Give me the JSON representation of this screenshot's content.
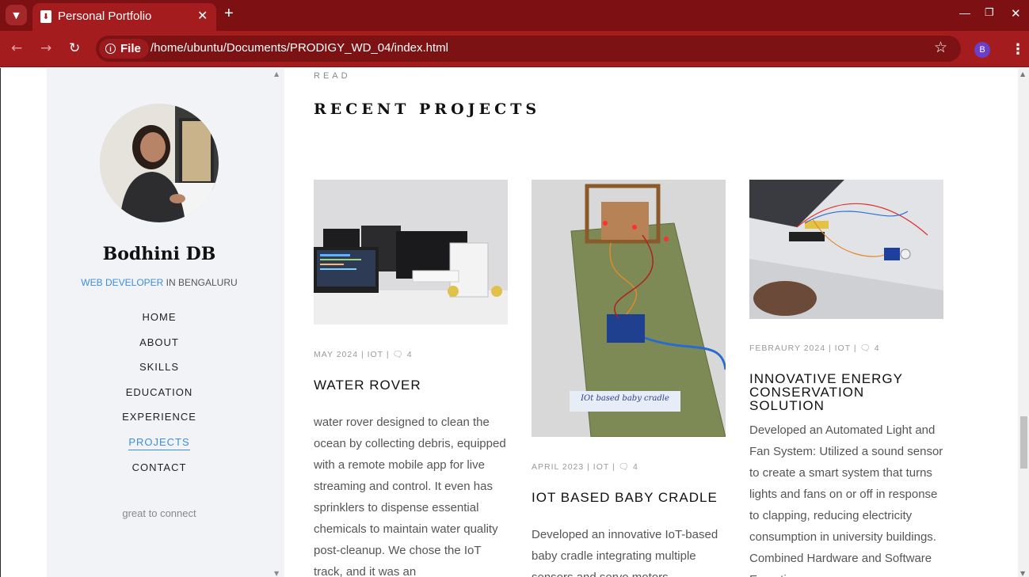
{
  "browser": {
    "tab_title": "Personal Portfolio",
    "url_chip": "File",
    "url": "/home/ubuntu/Documents/PRODIGY_WD_04/index.html",
    "profile_initial": "B"
  },
  "sidebar": {
    "name": "Bodhini DB",
    "role_highlight": "WEB DEVELOPER",
    "role_rest": " IN BENGALURU",
    "menu": [
      {
        "label": "HOME"
      },
      {
        "label": "ABOUT"
      },
      {
        "label": "SKILLS"
      },
      {
        "label": "EDUCATION"
      },
      {
        "label": "EXPERIENCE"
      },
      {
        "label": "PROJECTS",
        "active": true
      },
      {
        "label": "CONTACT"
      }
    ],
    "tagline": "great to connect"
  },
  "main": {
    "read_label": "READ",
    "section_title": "RECENT PROJECTS",
    "projects": [
      {
        "date": "MAY 2024",
        "category": "IOT",
        "comments": "4",
        "title": "WATER ROVER",
        "description": "water rover designed to clean the ocean by collecting debris, equipped with a remote mobile app for live streaming and control. It even has sprinklers to dispense essential chemicals to maintain water quality post-cleanup. We chose the IoT track, and it was an"
      },
      {
        "date": "APRIL 2023",
        "category": "IOT",
        "comments": "4",
        "title": "IOT BASED BABY CRADLE",
        "description": "Developed an innovative IoT-based baby cradle integrating multiple sensors and servo motors",
        "image_label": "IOt based baby cradle"
      },
      {
        "date": "FEBRAURY 2024",
        "category": "IOT",
        "comments": "4",
        "title": "INNOVATIVE ENERGY CONSERVATION SOLUTION",
        "description": "Developed an Automated Light and Fan System: Utilized a sound sensor to create a smart system that turns lights and fans on or off in response to clapping, reducing electricity consumption in university buildings. Combined Hardware and Software Expertise"
      }
    ]
  },
  "colors": {
    "tabbar": "#7c1012",
    "toolbar": "#a51c1f",
    "accent": "#3d8ed8",
    "sidebar_bg": "#f2f3f7"
  }
}
